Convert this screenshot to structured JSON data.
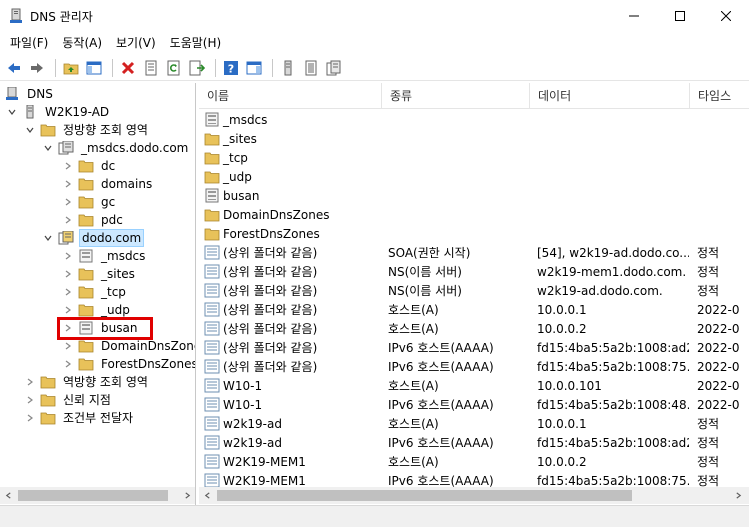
{
  "window": {
    "title": "DNS 관리자"
  },
  "menu": [
    "파일(F)",
    "동작(A)",
    "보기(V)",
    "도움말(H)"
  ],
  "toolbar": {
    "icons": [
      "back-arrow-icon",
      "forward-arrow-icon",
      "folder-up-icon",
      "console-tree-icon",
      "delete-icon",
      "properties-icon",
      "refresh-icon",
      "export-icon",
      "help-icon",
      "view-icon",
      "server-icon",
      "list-icon",
      "zone-icon"
    ]
  },
  "tree": {
    "root": "DNS",
    "server": "W2K19-AD",
    "forward_zones": "정방향 조회 영역",
    "msdcs_zone": "_msdcs.dodo.com",
    "msdcs_children": [
      "dc",
      "domains",
      "gc",
      "pdc"
    ],
    "dodo_zone": "dodo.com",
    "dodo_children": [
      "_msdcs",
      "_sites",
      "_tcp",
      "_udp",
      "busan",
      "DomainDnsZones",
      "ForestDnsZones"
    ],
    "reverse_zones": "역방향 조회 영역",
    "trust_points": "신뢰 지점",
    "conditional_forwarders": "조건부 전달자"
  },
  "columns": {
    "name": "이름",
    "type": "종류",
    "data": "데이터",
    "timestamp": "타임스"
  },
  "records": [
    {
      "name": "_msdcs",
      "type": "",
      "data": "",
      "ts": "",
      "icon": "delegated"
    },
    {
      "name": "_sites",
      "type": "",
      "data": "",
      "ts": "",
      "icon": "folder"
    },
    {
      "name": "_tcp",
      "type": "",
      "data": "",
      "ts": "",
      "icon": "folder"
    },
    {
      "name": "_udp",
      "type": "",
      "data": "",
      "ts": "",
      "icon": "folder"
    },
    {
      "name": "busan",
      "type": "",
      "data": "",
      "ts": "",
      "icon": "delegated"
    },
    {
      "name": "DomainDnsZones",
      "type": "",
      "data": "",
      "ts": "",
      "icon": "folder"
    },
    {
      "name": "ForestDnsZones",
      "type": "",
      "data": "",
      "ts": "",
      "icon": "folder"
    },
    {
      "name": "(상위 폴더와 같음)",
      "type": "SOA(권한 시작)",
      "data": "[54], w2k19-ad.dodo.co...",
      "ts": "정적",
      "icon": "record"
    },
    {
      "name": "(상위 폴더와 같음)",
      "type": "NS(이름 서버)",
      "data": "w2k19-mem1.dodo.com.",
      "ts": "정적",
      "icon": "record"
    },
    {
      "name": "(상위 폴더와 같음)",
      "type": "NS(이름 서버)",
      "data": "w2k19-ad.dodo.com.",
      "ts": "정적",
      "icon": "record"
    },
    {
      "name": "(상위 폴더와 같음)",
      "type": "호스트(A)",
      "data": "10.0.0.1",
      "ts": "2022-0",
      "icon": "record"
    },
    {
      "name": "(상위 폴더와 같음)",
      "type": "호스트(A)",
      "data": "10.0.0.2",
      "ts": "2022-0",
      "icon": "record"
    },
    {
      "name": "(상위 폴더와 같음)",
      "type": "IPv6 호스트(AAAA)",
      "data": "fd15:4ba5:5a2b:1008:ad2...",
      "ts": "2022-0",
      "icon": "record"
    },
    {
      "name": "(상위 폴더와 같음)",
      "type": "IPv6 호스트(AAAA)",
      "data": "fd15:4ba5:5a2b:1008:75...",
      "ts": "2022-0",
      "icon": "record"
    },
    {
      "name": "W10-1",
      "type": "호스트(A)",
      "data": "10.0.0.101",
      "ts": "2022-0",
      "icon": "record"
    },
    {
      "name": "W10-1",
      "type": "IPv6 호스트(AAAA)",
      "data": "fd15:4ba5:5a2b:1008:48...",
      "ts": "2022-0",
      "icon": "record"
    },
    {
      "name": "w2k19-ad",
      "type": "호스트(A)",
      "data": "10.0.0.1",
      "ts": "정적",
      "icon": "record"
    },
    {
      "name": "w2k19-ad",
      "type": "IPv6 호스트(AAAA)",
      "data": "fd15:4ba5:5a2b:1008:ad2...",
      "ts": "정적",
      "icon": "record"
    },
    {
      "name": "W2K19-MEM1",
      "type": "호스트(A)",
      "data": "10.0.0.2",
      "ts": "정적",
      "icon": "record"
    },
    {
      "name": "W2K19-MEM1",
      "type": "IPv6 호스트(AAAA)",
      "data": "fd15:4ba5:5a2b:1008:75...",
      "ts": "정적",
      "icon": "record"
    }
  ],
  "colors": {
    "folder": "#e8c25a",
    "selection": "#cce8ff",
    "highlight": "#e00000",
    "toolbar_blue": "#2b6cc4",
    "delete_red": "#d42020"
  }
}
